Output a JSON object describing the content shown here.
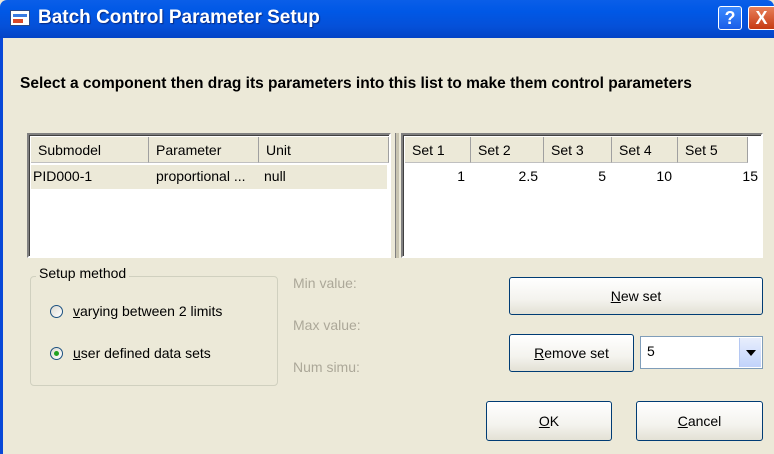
{
  "window": {
    "title": "Batch Control Parameter Setup",
    "help_label": "?",
    "close_label": "X"
  },
  "instruction": "Select a component then drag its parameters into this list to make them control parameters",
  "parameter_list": {
    "columns": [
      "Submodel",
      "Parameter",
      "Unit"
    ],
    "rows": [
      {
        "submodel": "PID000-1",
        "parameter": "proportional ...",
        "unit": "null"
      }
    ]
  },
  "sets_list": {
    "columns": [
      "Set 1",
      "Set 2",
      "Set 3",
      "Set 4",
      "Set 5"
    ],
    "rows": [
      [
        "1",
        "2.5",
        "5",
        "10",
        "15"
      ]
    ]
  },
  "setup_method": {
    "legend": "Setup method",
    "options": [
      {
        "mnemonic": "v",
        "rest": "arying between 2 limits",
        "checked": false
      },
      {
        "mnemonic": "u",
        "rest": "ser defined data sets",
        "checked": true
      }
    ]
  },
  "limits": {
    "min_label": "Min value:",
    "max_label": "Max value:",
    "num_label": "Num simu:"
  },
  "buttons": {
    "new_set": {
      "mnemonic": "N",
      "rest": "ew set"
    },
    "remove_set": {
      "mnemonic": "R",
      "rest": "emove set"
    },
    "ok": {
      "mnemonic": "O",
      "rest": "K"
    },
    "cancel": {
      "mnemonic": "C",
      "rest": "ancel"
    }
  },
  "set_selector": {
    "value": "5"
  },
  "colors": {
    "titlebar": "#0058e6",
    "dialog_bg": "#ece9d8",
    "radio_dot": "#21a121",
    "disabled_text": "#aca899"
  }
}
